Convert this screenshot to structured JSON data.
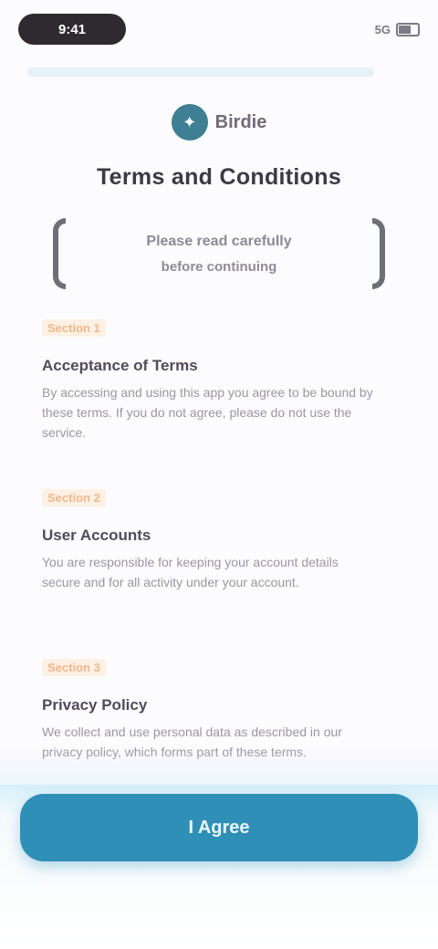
{
  "status_bar": {
    "time": "9:41",
    "signal": "5G"
  },
  "brand": {
    "logo_icon": "bird-logo-icon",
    "name": "Birdie"
  },
  "page": {
    "title": "Terms and Conditions",
    "banner_line_1": "Please read carefully",
    "banner_line_2": "before continuing"
  },
  "sections": [
    {
      "tag": "Section 1",
      "heading": "Acceptance of Terms",
      "body": "By accessing and using this app you agree to be bound by these terms. If you do not agree, please do not use the service."
    },
    {
      "tag": "Section 2",
      "heading": "User Accounts",
      "body": "You are responsible for keeping your account details secure and for all activity under your account."
    },
    {
      "tag": "Section 3",
      "heading": "Privacy Policy",
      "body": "We collect and use personal data as described in our privacy policy, which forms part of these terms."
    }
  ],
  "cta": {
    "label": "I Agree"
  },
  "colors": {
    "accent": "#2f8fb6",
    "tag": "#efb98c",
    "status_pill": "#2f2a30"
  }
}
